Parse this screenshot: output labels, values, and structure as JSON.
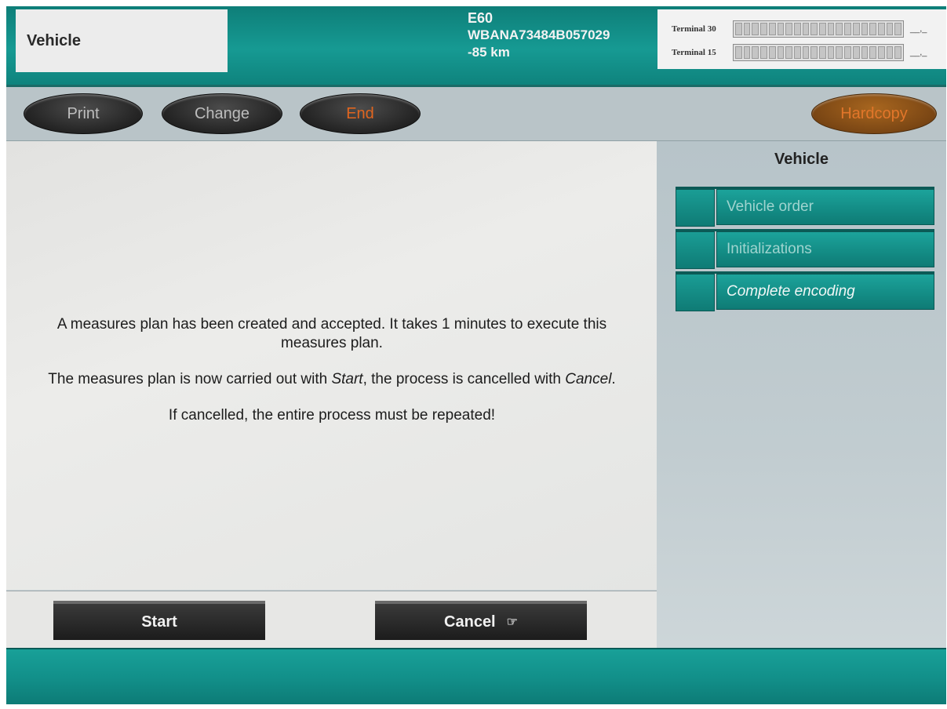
{
  "header": {
    "title": "Vehicle",
    "model": "E60",
    "vin": "WBANA73484B057029",
    "mileage": "-85 km",
    "terminals": [
      {
        "label": "Terminal 30",
        "value": "__,_"
      },
      {
        "label": "Terminal 15",
        "value": "__,_"
      }
    ]
  },
  "toolbar": {
    "print_label": "Print",
    "change_label": "Change",
    "end_label": "End",
    "hardcopy_label": "Hardcopy"
  },
  "message": {
    "line1": "A measures plan has been created and accepted. It takes 1 minutes to execute this measures plan.",
    "line2_pre": "The measures plan is now carried out with ",
    "line2_start": "Start",
    "line2_mid": ", the process is cancelled with ",
    "line2_cancel": "Cancel",
    "line2_end": ".",
    "line3": "If cancelled, the entire process must be repeated!"
  },
  "sidebar": {
    "title": "Vehicle",
    "items": [
      {
        "label": "Vehicle order",
        "active": false
      },
      {
        "label": "Initializations",
        "active": false
      },
      {
        "label": "Complete encoding",
        "active": true
      }
    ]
  },
  "actions": {
    "start_label": "Start",
    "cancel_label": "Cancel",
    "cancel_icon": "pointing-hand-icon"
  },
  "colors": {
    "teal": "#169a93",
    "end_text": "#e0651f",
    "hardcopy_bg": "#7a4614"
  }
}
